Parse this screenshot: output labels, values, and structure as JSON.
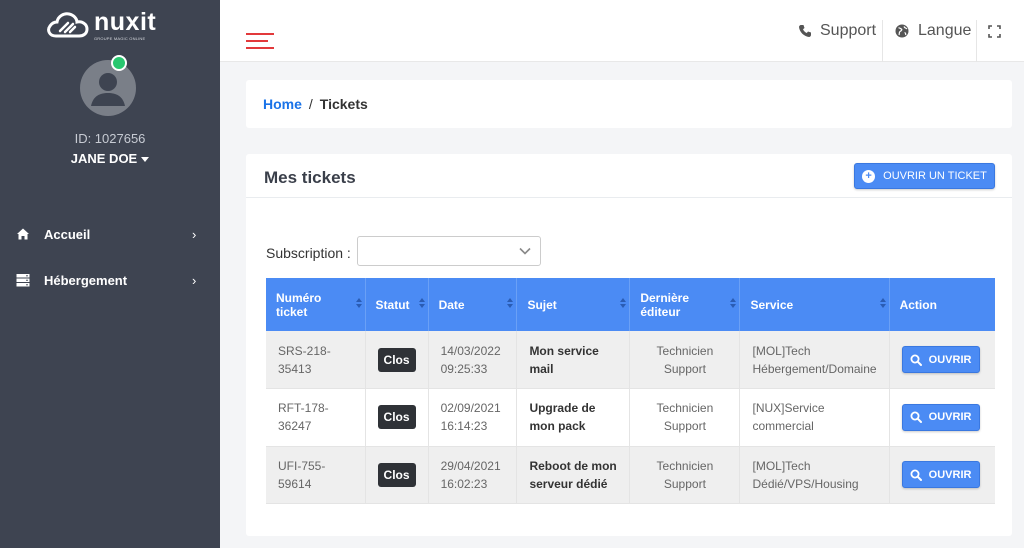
{
  "brand": {
    "name": "nuxit",
    "tagline": "GROUPE MAGIC ONLINE"
  },
  "user": {
    "id_label": "ID: 1027656",
    "name": "JANE DOE"
  },
  "sidebar": {
    "items": [
      {
        "label": "Accueil",
        "icon": "home-icon"
      },
      {
        "label": "Hébergement",
        "icon": "server-icon"
      }
    ]
  },
  "topbar": {
    "support_label": "Support",
    "language_label": "Langue"
  },
  "breadcrumb": {
    "home": "Home",
    "separator": "/",
    "current": "Tickets"
  },
  "tickets": {
    "title": "Mes tickets",
    "open_ticket_label": "OUVRIR UN TICKET",
    "subscription_label": "Subscription :",
    "subscription_value": "",
    "columns": [
      "Numéro ticket",
      "Statut",
      "Date",
      "Sujet",
      "Dernière éditeur",
      "Service",
      "Action"
    ],
    "rows": [
      {
        "number": "SRS-218-35413",
        "number_l1": "SRS-218-",
        "number_l2": "35413",
        "status": "Clos",
        "date": "14/03/2022",
        "time": "09:25:33",
        "subject_l1": "Mon service",
        "subject_l2": "mail",
        "editor_l1": "Technicien",
        "editor_l2": "Support",
        "service_l1": "[MOL]Tech",
        "service_l2": "Hébergement/Domaine",
        "action": "OUVRIR"
      },
      {
        "number": "RFT-178-36247",
        "number_l1": "RFT-178-",
        "number_l2": "36247",
        "status": "Clos",
        "date": "02/09/2021",
        "time": "16:14:23",
        "subject_l1": "Upgrade de",
        "subject_l2": "mon pack",
        "editor_l1": "Technicien",
        "editor_l2": "Support",
        "service_l1": "[NUX]Service",
        "service_l2": "commercial",
        "action": "OUVRIR"
      },
      {
        "number": "UFI-755-59614",
        "number_l1": "UFI-755-",
        "number_l2": "59614",
        "status": "Clos",
        "date": "29/04/2021",
        "time": "16:02:23",
        "subject_l1": "Reboot de mon",
        "subject_l2": "serveur dédié",
        "editor_l1": "Technicien",
        "editor_l2": "Support",
        "service_l1": "[MOL]Tech",
        "service_l2": "Dédié/VPS/Housing",
        "action": "OUVRIR"
      }
    ]
  },
  "colors": {
    "sidebar_bg": "#3e4451",
    "accent_blue": "#4b8bf4",
    "hamburger_red": "#e2393b",
    "online_green": "#28c76f",
    "status_dark": "#2f3237"
  }
}
